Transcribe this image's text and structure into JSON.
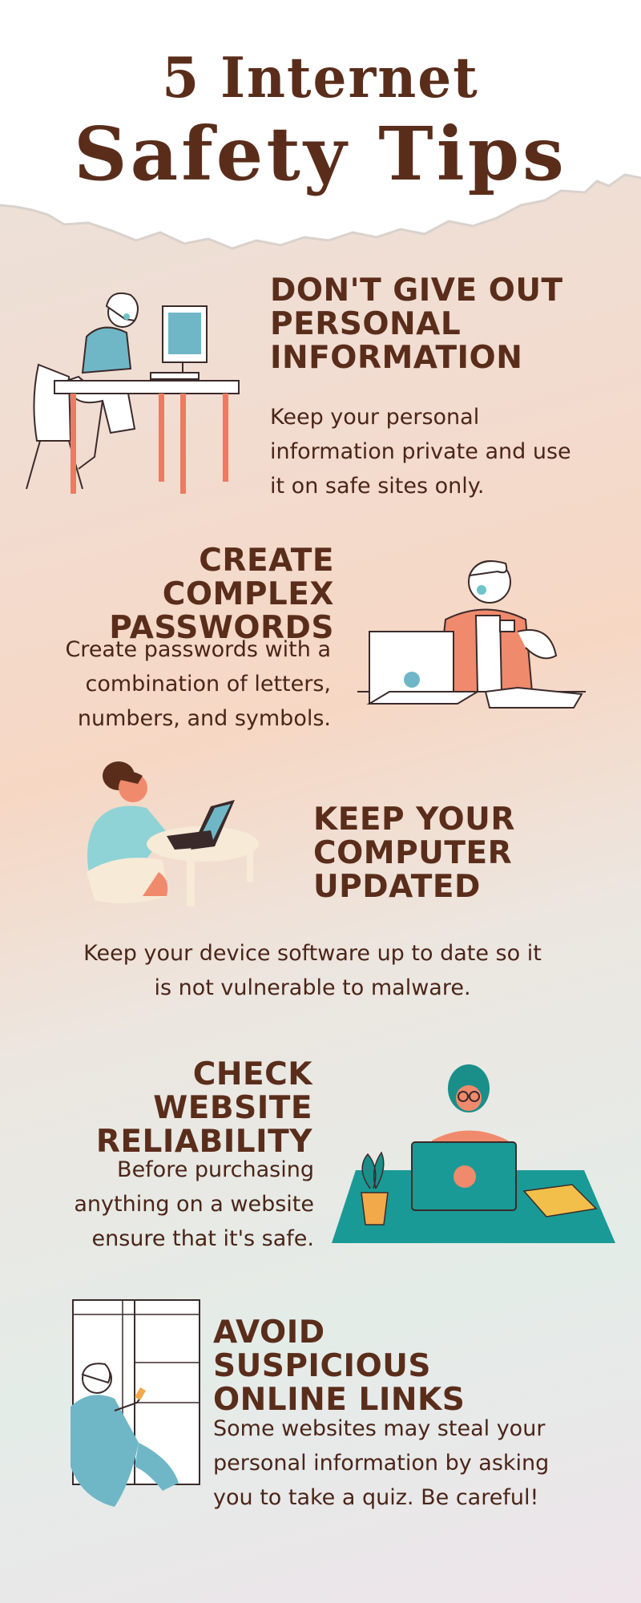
{
  "header": {
    "title_line1": "5 Internet",
    "title_line2": "Safety Tips"
  },
  "tips": [
    {
      "heading": "Don't give out personal information",
      "body": "Keep your personal information private and use it on safe sites only.",
      "illustration": "woman-at-desk-computer"
    },
    {
      "heading": "Create complex passwords",
      "body": "Create passwords with a combination of letters, numbers, and symbols.",
      "illustration": "man-laptop-coffee"
    },
    {
      "heading": "Keep your computer updated",
      "body": "Keep your device software up to date so it is not vulnerable to malware.",
      "illustration": "woman-laptop-table"
    },
    {
      "heading": "Check website reliability",
      "body": "Before purchasing anything on a website ensure that it's safe.",
      "illustration": "woman-laptop-plant"
    },
    {
      "heading": "Avoid suspicious online links",
      "body": "Some websites may steal your personal information by asking you to take a quiz. Be careful!",
      "illustration": "woman-window-phone"
    }
  ],
  "colors": {
    "title": "#5a2d1b",
    "accent_coral": "#f08a6c",
    "accent_teal": "#1a9a96",
    "accent_blue": "#8fd3d6"
  }
}
